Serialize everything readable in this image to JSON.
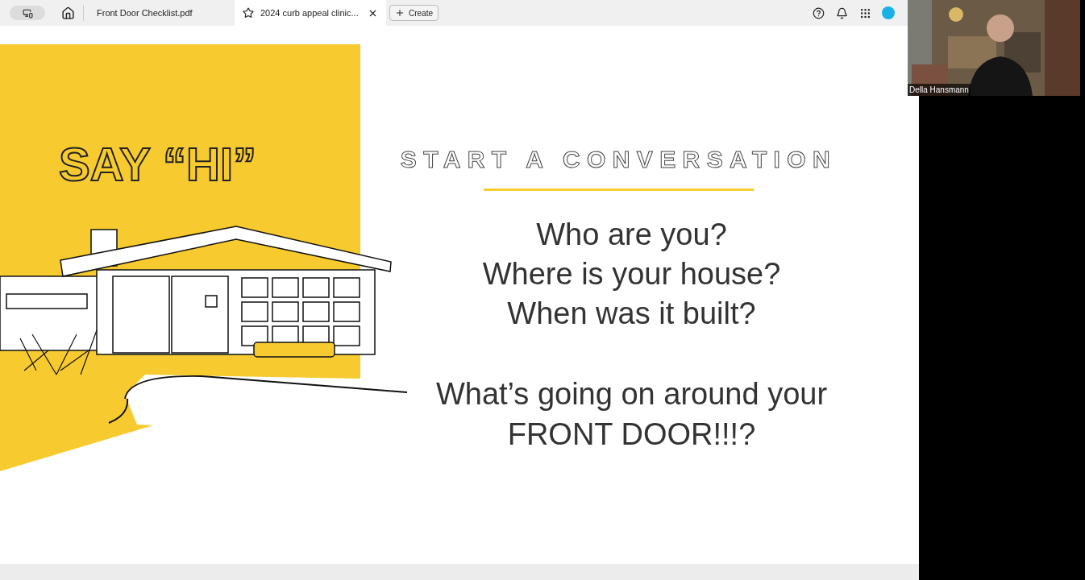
{
  "toolbar": {
    "tabs": [
      {
        "label": "Front Door Checklist.pdf",
        "selected": false
      },
      {
        "label": "2024 curb appeal clinic...",
        "selected": true
      }
    ],
    "create_button": "Create"
  },
  "slide": {
    "headline": "SAY “HI”",
    "title": "START A CONVERSATION",
    "questions": [
      "Who are you?",
      "Where is your house?",
      "When was it built?"
    ],
    "closing": [
      "What’s going on around your",
      "FRONT DOOR!!!?"
    ]
  },
  "video": {
    "participant_name": "Della Hansmann"
  }
}
